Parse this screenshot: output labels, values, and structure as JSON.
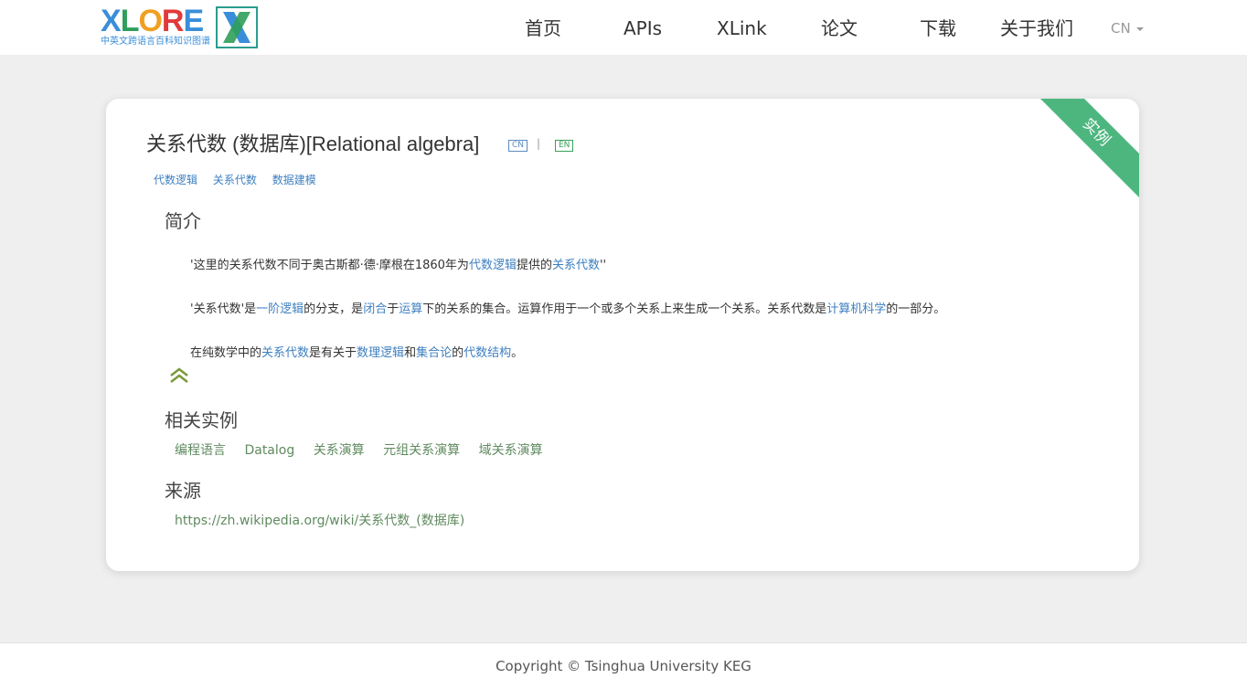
{
  "header": {
    "logo": {
      "letters": [
        "X",
        "L",
        "O",
        "R",
        "E"
      ],
      "letter_colors": [
        "#3a8ed9",
        "#2f9e5a",
        "#f0a020",
        "#e03a3a",
        "#3a8ed9"
      ],
      "subtitle": "中英文跨语言百科知识图谱",
      "mark": "X"
    },
    "nav": {
      "home": "首页",
      "apis": "APIs",
      "xlink": "XLink",
      "papers": "论文",
      "download": "下载",
      "about": "关于我们"
    },
    "language": "CN"
  },
  "entity": {
    "ribbon": "实例",
    "title": "关系代数 (数据库)[Relational algebra]",
    "tag_cn": "CN",
    "separator": "|",
    "tag_en": "EN",
    "categories": [
      "代数逻辑",
      "关系代数",
      "数据建模"
    ]
  },
  "abstract": {
    "heading": "简介",
    "p1": {
      "a": "'这里的关系代数不同于奥古斯都·德·摩根在1860年为",
      "link1": "代数逻辑",
      "b": "提供的",
      "link2": "关系代数",
      "c": "''"
    },
    "p2": {
      "a": "'关系代数'是",
      "link1": "一阶逻辑",
      "b": "的分支，是",
      "link2": "闭合",
      "c": "于",
      "link3": "运算",
      "d": "下的关系的集合。运算作用于一个或多个关系上来生成一个关系。关系代数是",
      "link4": "计算机科学",
      "e": "的一部分。"
    },
    "p3": {
      "a": "在纯数学中的",
      "link1": "关系代数",
      "b": "是有关于",
      "link2": "数理逻辑",
      "c": "和",
      "link3": "集合论",
      "d": "的",
      "link4": "代数结构",
      "e": "。"
    }
  },
  "related": {
    "heading": "相关实例",
    "items": [
      "编程语言",
      "Datalog",
      "关系演算",
      "元组关系演算",
      "域关系演算"
    ]
  },
  "source": {
    "heading": "来源",
    "url": "https://zh.wikipedia.org/wiki/关系代数_(数据库)"
  },
  "footer": {
    "copyright": "Copyright © Tsinghua University KEG"
  }
}
